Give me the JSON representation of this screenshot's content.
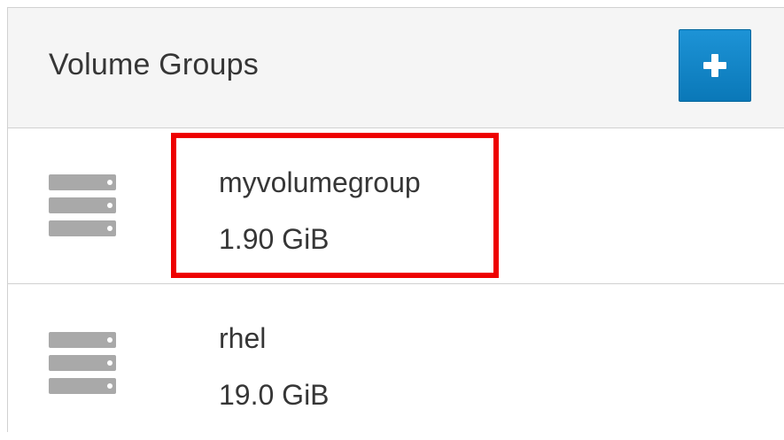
{
  "panel": {
    "title": "Volume Groups",
    "add_button": {
      "icon": "plus-icon",
      "color": "#0a78b8"
    }
  },
  "volume_groups": [
    {
      "name": "myvolumegroup",
      "size": "1.90 GiB",
      "icon": "drive-stack-icon",
      "highlighted": true
    },
    {
      "name": "rhel",
      "size": "19.0 GiB",
      "icon": "drive-stack-icon",
      "highlighted": false
    }
  ],
  "highlight": {
    "color": "#ee0000"
  }
}
